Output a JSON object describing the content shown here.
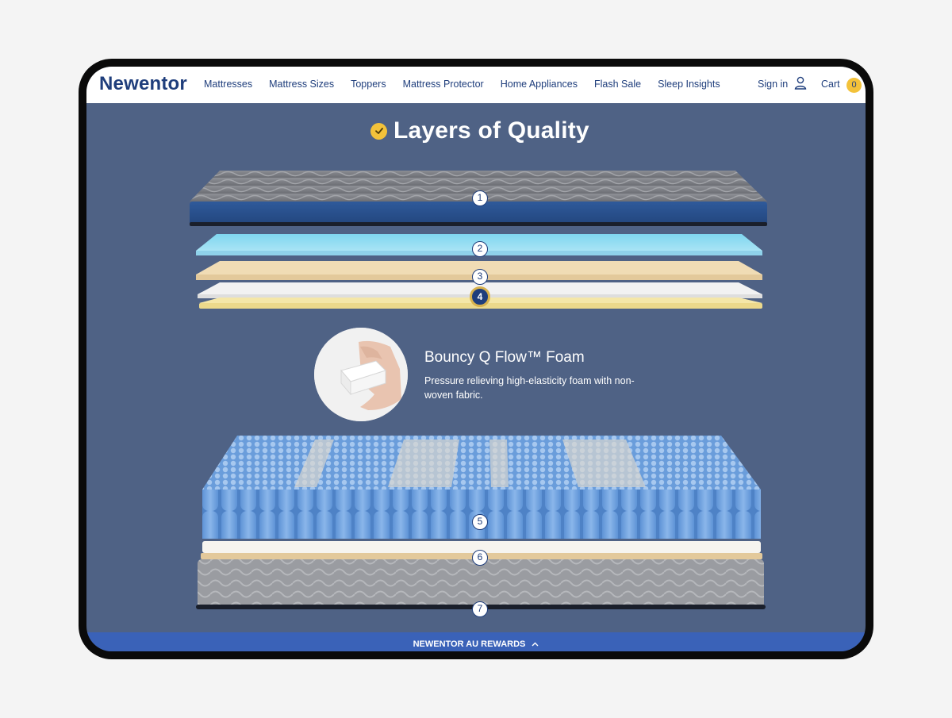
{
  "header": {
    "logo": "Newentor",
    "nav": [
      {
        "label": "Mattresses"
      },
      {
        "label": "Mattress Sizes"
      },
      {
        "label": "Toppers"
      },
      {
        "label": "Mattress Protector"
      },
      {
        "label": "Home Appliances"
      },
      {
        "label": "Flash Sale"
      },
      {
        "label": "Sleep Insights"
      }
    ],
    "signin": "Sign in",
    "cart": "Cart",
    "cart_count": "0"
  },
  "section": {
    "title": "Layers of Quality",
    "markers": [
      "1",
      "2",
      "3",
      "4",
      "5",
      "6",
      "7"
    ],
    "active_marker": "4"
  },
  "feature": {
    "title": "Bouncy Q Flow™ Foam",
    "description": "Pressure relieving high-elasticity foam with non-woven fabric."
  },
  "footer_bar": {
    "label": "NEWENTOR AU REWARDS"
  },
  "colors": {
    "brand": "#1f3e7c",
    "accent": "#f3c23a",
    "background": "#4f6285",
    "rewards_bar": "#3a62b8"
  }
}
